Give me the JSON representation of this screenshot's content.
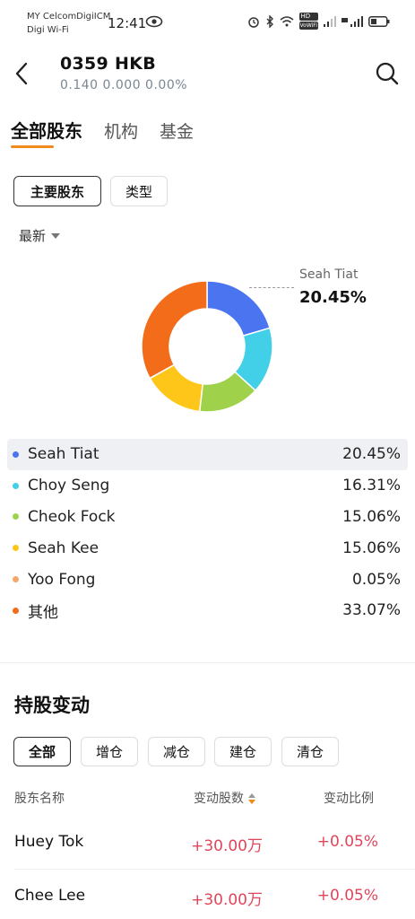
{
  "status_bar": {
    "carrier_line1": "MY CelcomDigiICM",
    "carrier_line2": "Digi Wi-Fi",
    "time": "12:41",
    "hd_label": "HD",
    "volte_label": "VoWiFi"
  },
  "header": {
    "stock_code": "0359  HKB",
    "quote": "0.140  0.000  0.00%"
  },
  "tabs": [
    {
      "label": "全部股东",
      "active": true
    },
    {
      "label": "机构",
      "active": false
    },
    {
      "label": "基金",
      "active": false
    }
  ],
  "chips": {
    "main_label": "主要股东",
    "type_label": "类型"
  },
  "sort_dropdown": "最新",
  "callout": {
    "name": "Seah Tiat",
    "percent": "20.45%"
  },
  "holders": [
    {
      "name": "Seah Tiat",
      "percent": "20.45%",
      "value": 20.45,
      "color": "#4a74f0"
    },
    {
      "name": "Choy Seng",
      "percent": "16.31%",
      "value": 16.31,
      "color": "#41d0e8"
    },
    {
      "name": "Cheok Fock",
      "percent": "15.06%",
      "value": 15.06,
      "color": "#9fd24a"
    },
    {
      "name": "Seah Kee",
      "percent": "15.06%",
      "value": 15.06,
      "color": "#ffc61a"
    },
    {
      "name": "Yoo Fong",
      "percent": "0.05%",
      "value": 0.05,
      "color": "#f5a86b"
    },
    {
      "name": "其他",
      "percent": "33.07%",
      "value": 33.07,
      "color": "#f36c1a"
    }
  ],
  "holdings_change": {
    "title": "持股变动",
    "filters": [
      "全部",
      "增仓",
      "减仓",
      "建仓",
      "清仓"
    ],
    "columns": [
      "股东名称",
      "变动股数",
      "变动比例"
    ],
    "rows": [
      {
        "name": "Huey Tok",
        "shares": "+30.00万",
        "ratio": "+0.05%"
      },
      {
        "name": "Chee Lee",
        "shares": "+30.00万",
        "ratio": "+0.05%"
      }
    ]
  }
}
